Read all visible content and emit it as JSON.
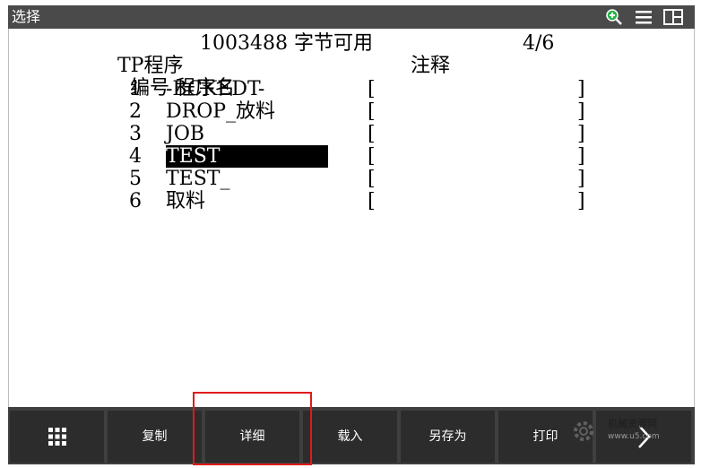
{
  "titlebar": {
    "title": "选择"
  },
  "header": {
    "program_type": "TP程序",
    "bytes_free": "1003488 字节可用",
    "page_indicator": "4/6",
    "col_number": "编号",
    "col_name": "程序名",
    "col_comment": "注释"
  },
  "programs": [
    {
      "number": "1",
      "name": "-BCKEDT-",
      "comment_open": "[",
      "comment_close": "]"
    },
    {
      "number": "2",
      "name": "DROP_放料",
      "comment_open": "[",
      "comment_close": "]"
    },
    {
      "number": "3",
      "name": "JOB",
      "comment_open": "[",
      "comment_close": "]"
    },
    {
      "number": "4",
      "name": "TEST",
      "comment_open": "[",
      "comment_close": "]"
    },
    {
      "number": "5",
      "name": "TEST_",
      "comment_open": "[",
      "comment_close": "]"
    },
    {
      "number": "6",
      "name": "取料",
      "comment_open": "[",
      "comment_close": "]"
    }
  ],
  "selected_row": 4,
  "softkeys": [
    {
      "label": "",
      "icon": "grid-icon"
    },
    {
      "label": "复制"
    },
    {
      "label": "详细"
    },
    {
      "label": "载入"
    },
    {
      "label": "另存为"
    },
    {
      "label": "打印"
    },
    {
      "label": "",
      "icon": "chevron-right-icon"
    }
  ],
  "watermark": {
    "line1": "机械资源网",
    "line2": "www.u5.com"
  },
  "colors": {
    "titlebar": "#4a4a4a",
    "softkey_bar": "#3f3f3f",
    "highlight": "#e01b1b",
    "selection": "#000000"
  }
}
